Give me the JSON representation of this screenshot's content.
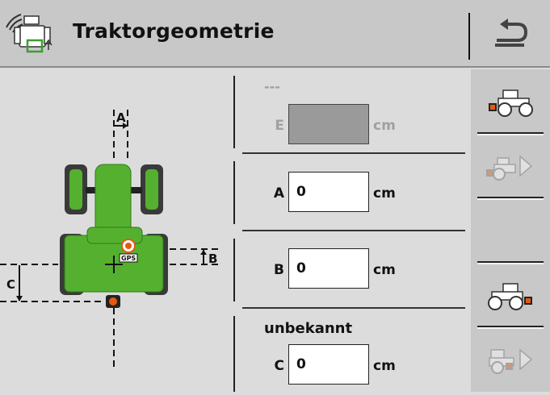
{
  "header": {
    "title": "Traktorgeometrie",
    "app_icon": "tractor-gps-settings-icon",
    "back_icon": "return-arrow-icon"
  },
  "diagram": {
    "labels": {
      "a": "A",
      "b": "B",
      "c": "C",
      "gps": "GPS"
    },
    "tractor_color": "#55b030",
    "marker_color": "#e35a10"
  },
  "fields": {
    "e": {
      "label": "E",
      "header": "---",
      "value": "",
      "unit": "cm"
    },
    "a": {
      "label": "A",
      "value": "0",
      "unit": "cm"
    },
    "b": {
      "label": "B",
      "value": "0",
      "unit": "cm"
    },
    "c": {
      "label": "C",
      "header": "unbekannt",
      "value": "0",
      "unit": "cm"
    }
  },
  "sidebar": [
    {
      "icon": "tractor-hitch-rear-icon",
      "enabled": true
    },
    {
      "icon": "tractor-next-disabled-icon",
      "enabled": false
    },
    {
      "icon": "tractor-hitch-front-icon",
      "enabled": true
    },
    {
      "icon": "implement-next-disabled-icon",
      "enabled": false
    }
  ]
}
